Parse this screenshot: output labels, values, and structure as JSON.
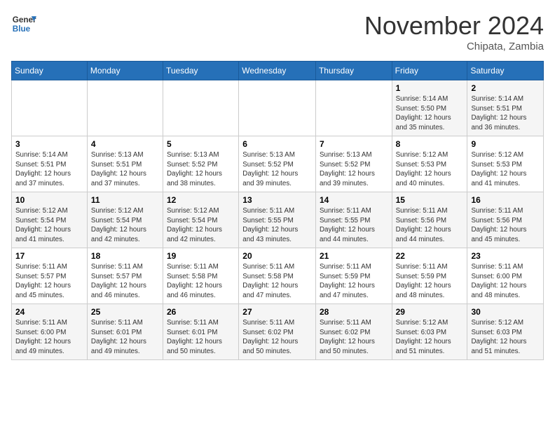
{
  "header": {
    "logo_general": "General",
    "logo_blue": "Blue",
    "month_title": "November 2024",
    "location": "Chipata, Zambia"
  },
  "days_of_week": [
    "Sunday",
    "Monday",
    "Tuesday",
    "Wednesday",
    "Thursday",
    "Friday",
    "Saturday"
  ],
  "weeks": [
    [
      {
        "num": "",
        "info": ""
      },
      {
        "num": "",
        "info": ""
      },
      {
        "num": "",
        "info": ""
      },
      {
        "num": "",
        "info": ""
      },
      {
        "num": "",
        "info": ""
      },
      {
        "num": "1",
        "info": "Sunrise: 5:14 AM\nSunset: 5:50 PM\nDaylight: 12 hours\nand 35 minutes."
      },
      {
        "num": "2",
        "info": "Sunrise: 5:14 AM\nSunset: 5:51 PM\nDaylight: 12 hours\nand 36 minutes."
      }
    ],
    [
      {
        "num": "3",
        "info": "Sunrise: 5:14 AM\nSunset: 5:51 PM\nDaylight: 12 hours\nand 37 minutes."
      },
      {
        "num": "4",
        "info": "Sunrise: 5:13 AM\nSunset: 5:51 PM\nDaylight: 12 hours\nand 37 minutes."
      },
      {
        "num": "5",
        "info": "Sunrise: 5:13 AM\nSunset: 5:52 PM\nDaylight: 12 hours\nand 38 minutes."
      },
      {
        "num": "6",
        "info": "Sunrise: 5:13 AM\nSunset: 5:52 PM\nDaylight: 12 hours\nand 39 minutes."
      },
      {
        "num": "7",
        "info": "Sunrise: 5:13 AM\nSunset: 5:52 PM\nDaylight: 12 hours\nand 39 minutes."
      },
      {
        "num": "8",
        "info": "Sunrise: 5:12 AM\nSunset: 5:53 PM\nDaylight: 12 hours\nand 40 minutes."
      },
      {
        "num": "9",
        "info": "Sunrise: 5:12 AM\nSunset: 5:53 PM\nDaylight: 12 hours\nand 41 minutes."
      }
    ],
    [
      {
        "num": "10",
        "info": "Sunrise: 5:12 AM\nSunset: 5:54 PM\nDaylight: 12 hours\nand 41 minutes."
      },
      {
        "num": "11",
        "info": "Sunrise: 5:12 AM\nSunset: 5:54 PM\nDaylight: 12 hours\nand 42 minutes."
      },
      {
        "num": "12",
        "info": "Sunrise: 5:12 AM\nSunset: 5:54 PM\nDaylight: 12 hours\nand 42 minutes."
      },
      {
        "num": "13",
        "info": "Sunrise: 5:11 AM\nSunset: 5:55 PM\nDaylight: 12 hours\nand 43 minutes."
      },
      {
        "num": "14",
        "info": "Sunrise: 5:11 AM\nSunset: 5:55 PM\nDaylight: 12 hours\nand 44 minutes."
      },
      {
        "num": "15",
        "info": "Sunrise: 5:11 AM\nSunset: 5:56 PM\nDaylight: 12 hours\nand 44 minutes."
      },
      {
        "num": "16",
        "info": "Sunrise: 5:11 AM\nSunset: 5:56 PM\nDaylight: 12 hours\nand 45 minutes."
      }
    ],
    [
      {
        "num": "17",
        "info": "Sunrise: 5:11 AM\nSunset: 5:57 PM\nDaylight: 12 hours\nand 45 minutes."
      },
      {
        "num": "18",
        "info": "Sunrise: 5:11 AM\nSunset: 5:57 PM\nDaylight: 12 hours\nand 46 minutes."
      },
      {
        "num": "19",
        "info": "Sunrise: 5:11 AM\nSunset: 5:58 PM\nDaylight: 12 hours\nand 46 minutes."
      },
      {
        "num": "20",
        "info": "Sunrise: 5:11 AM\nSunset: 5:58 PM\nDaylight: 12 hours\nand 47 minutes."
      },
      {
        "num": "21",
        "info": "Sunrise: 5:11 AM\nSunset: 5:59 PM\nDaylight: 12 hours\nand 47 minutes."
      },
      {
        "num": "22",
        "info": "Sunrise: 5:11 AM\nSunset: 5:59 PM\nDaylight: 12 hours\nand 48 minutes."
      },
      {
        "num": "23",
        "info": "Sunrise: 5:11 AM\nSunset: 6:00 PM\nDaylight: 12 hours\nand 48 minutes."
      }
    ],
    [
      {
        "num": "24",
        "info": "Sunrise: 5:11 AM\nSunset: 6:00 PM\nDaylight: 12 hours\nand 49 minutes."
      },
      {
        "num": "25",
        "info": "Sunrise: 5:11 AM\nSunset: 6:01 PM\nDaylight: 12 hours\nand 49 minutes."
      },
      {
        "num": "26",
        "info": "Sunrise: 5:11 AM\nSunset: 6:01 PM\nDaylight: 12 hours\nand 50 minutes."
      },
      {
        "num": "27",
        "info": "Sunrise: 5:11 AM\nSunset: 6:02 PM\nDaylight: 12 hours\nand 50 minutes."
      },
      {
        "num": "28",
        "info": "Sunrise: 5:11 AM\nSunset: 6:02 PM\nDaylight: 12 hours\nand 50 minutes."
      },
      {
        "num": "29",
        "info": "Sunrise: 5:12 AM\nSunset: 6:03 PM\nDaylight: 12 hours\nand 51 minutes."
      },
      {
        "num": "30",
        "info": "Sunrise: 5:12 AM\nSunset: 6:03 PM\nDaylight: 12 hours\nand 51 minutes."
      }
    ]
  ]
}
